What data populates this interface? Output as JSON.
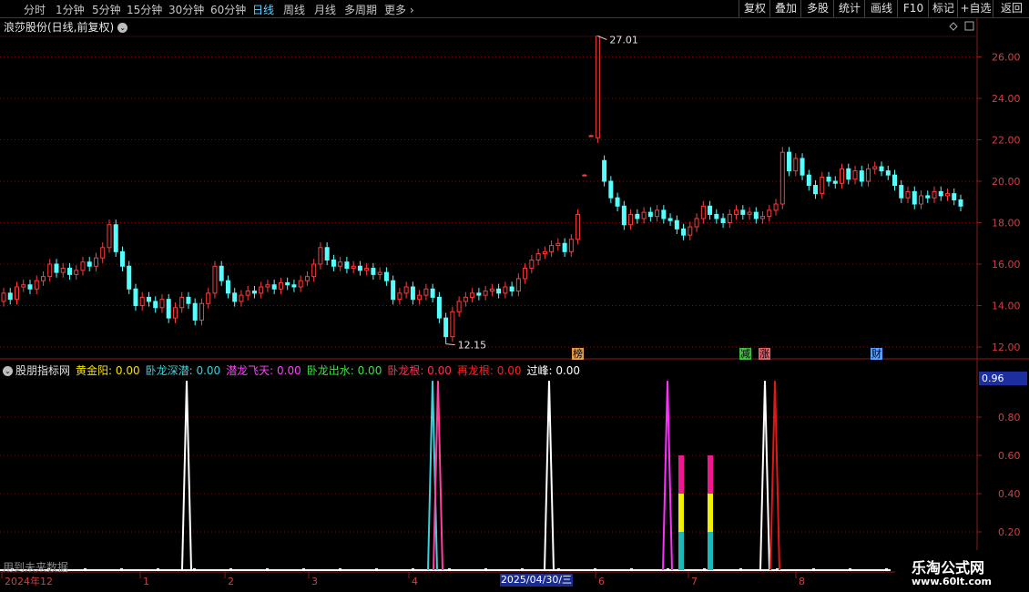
{
  "toolbar": {
    "timeframes": [
      {
        "label": "分时",
        "x": 26
      },
      {
        "label": "1分钟",
        "x": 61
      },
      {
        "label": "5分钟",
        "x": 101
      },
      {
        "label": "15分钟",
        "x": 139
      },
      {
        "label": "30分钟",
        "x": 185
      },
      {
        "label": "60分钟",
        "x": 231
      },
      {
        "label": "日线",
        "x": 277,
        "active": true
      },
      {
        "label": "周线",
        "x": 311
      },
      {
        "label": "月线",
        "x": 345
      },
      {
        "label": "多周期",
        "x": 378
      },
      {
        "label": "更多 ›",
        "x": 422
      }
    ],
    "right_buttons": [
      {
        "label": "复权",
        "x": 811,
        "w": 34
      },
      {
        "label": "叠加",
        "x": 845,
        "w": 34
      },
      {
        "label": "多股",
        "x": 879,
        "w": 36
      },
      {
        "label": "统计",
        "x": 915,
        "w": 34
      },
      {
        "label": "画线",
        "x": 949,
        "w": 36
      },
      {
        "label": "F10",
        "x": 985,
        "w": 34
      },
      {
        "label": "标记",
        "x": 1019,
        "w": 32
      },
      {
        "label": "+自选",
        "x": 1051,
        "w": 39
      },
      {
        "label": "返回",
        "x": 1090,
        "w": 40
      }
    ]
  },
  "price_panel": {
    "title": "浪莎股份(日线,前复权)",
    "y_ticks": [
      "26.00",
      "24.00",
      "22.00",
      "20.00",
      "18.00",
      "16.00",
      "14.00",
      "12.00"
    ],
    "high_label": "27.01",
    "low_label": "12.15",
    "event_tags": [
      {
        "label": "榜",
        "color": "#e59a4c"
      },
      {
        "label": "减",
        "color": "#3fbf3f"
      },
      {
        "label": "涨",
        "color": "#e0606a"
      },
      {
        "label": "财",
        "color": "#5aa0ff"
      }
    ]
  },
  "indicator_panel": {
    "name": "股朋指标网",
    "series": [
      {
        "label": "黄金阳: 0.00",
        "color": "#f5e000"
      },
      {
        "label": "卧龙深潜: 0.00",
        "color": "#3fd0d8"
      },
      {
        "label": "潜龙飞天: 0.00",
        "color": "#ff40ff"
      },
      {
        "label": "卧龙出水: 0.00",
        "color": "#40e040"
      },
      {
        "label": "卧龙根: 0.00",
        "color": "#ff3050"
      },
      {
        "label": "再龙根: 0.00",
        "color": "#ff2020"
      },
      {
        "label": "过峰: 0.00",
        "color": "#ffffff"
      }
    ],
    "y_ticks": [
      "0.80",
      "0.60",
      "0.40",
      "0.20"
    ],
    "current_value": "0.96"
  },
  "x_axis": {
    "labels": [
      "2024年12",
      "1",
      "2",
      "3",
      "4",
      "6",
      "7",
      "8"
    ],
    "selected_date": "2025/04/30/三"
  },
  "footer_note": "用到未来数据",
  "watermark": {
    "line1": "乐淘公式网",
    "line2": "www.60lt.com"
  },
  "colors": {
    "up": "#ff3c3c",
    "down": "#54ffff",
    "grid": "#7a1010",
    "axis": "#8b1a1a"
  }
}
